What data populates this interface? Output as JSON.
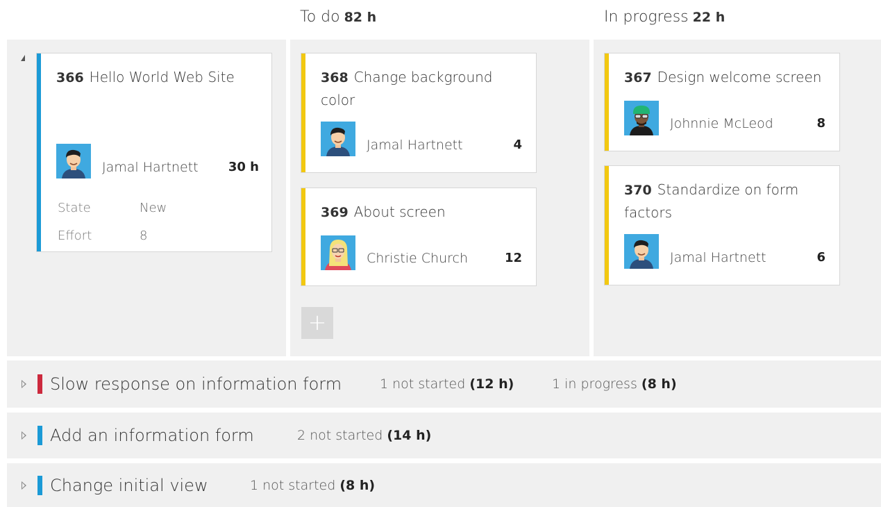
{
  "columns": {
    "todo": {
      "label": "To do",
      "count": "82 h"
    },
    "in_progress": {
      "label": "In progress",
      "count": "22 h"
    }
  },
  "colors": {
    "pbi_stripe": "#1b9ad6",
    "task_stripe": "#f2c811",
    "bug_bar": "#cc293d",
    "pbi_bar": "#1b9ad6",
    "panel_bg": "#f0f0f0"
  },
  "parent_card": {
    "id": "366",
    "title": "Hello World Web Site",
    "assignee": "Jamal Hartnett",
    "hours": "30 h",
    "fields": [
      {
        "label": "State",
        "value": "New"
      },
      {
        "label": "Effort",
        "value": "8"
      }
    ]
  },
  "todo_cards": [
    {
      "id": "368",
      "title": "Change background color",
      "assignee": "Jamal Hartnett",
      "hours": "4"
    },
    {
      "id": "369",
      "title": "About screen",
      "assignee": "Christie Church",
      "hours": "12"
    }
  ],
  "in_progress_cards": [
    {
      "id": "367",
      "title": "Design welcome screen",
      "assignee": "Johnnie McLeod",
      "hours": "8"
    },
    {
      "id": "370",
      "title": "Standardize on form factors",
      "assignee": "Jamal Hartnett",
      "hours": "6"
    }
  ],
  "add_button": {
    "label": "+"
  },
  "rows": [
    {
      "title": "Slow response on information form",
      "summaries": [
        {
          "text": "1 not started",
          "hours": "(12 h)"
        },
        {
          "text": "1 in progress",
          "hours": "(8 h)"
        }
      ]
    },
    {
      "title": "Add an information form",
      "summaries": [
        {
          "text": "2 not started",
          "hours": "(14 h)"
        }
      ]
    },
    {
      "title": "Change initial view",
      "summaries": [
        {
          "text": "1 not started",
          "hours": "(8 h)"
        }
      ]
    }
  ]
}
